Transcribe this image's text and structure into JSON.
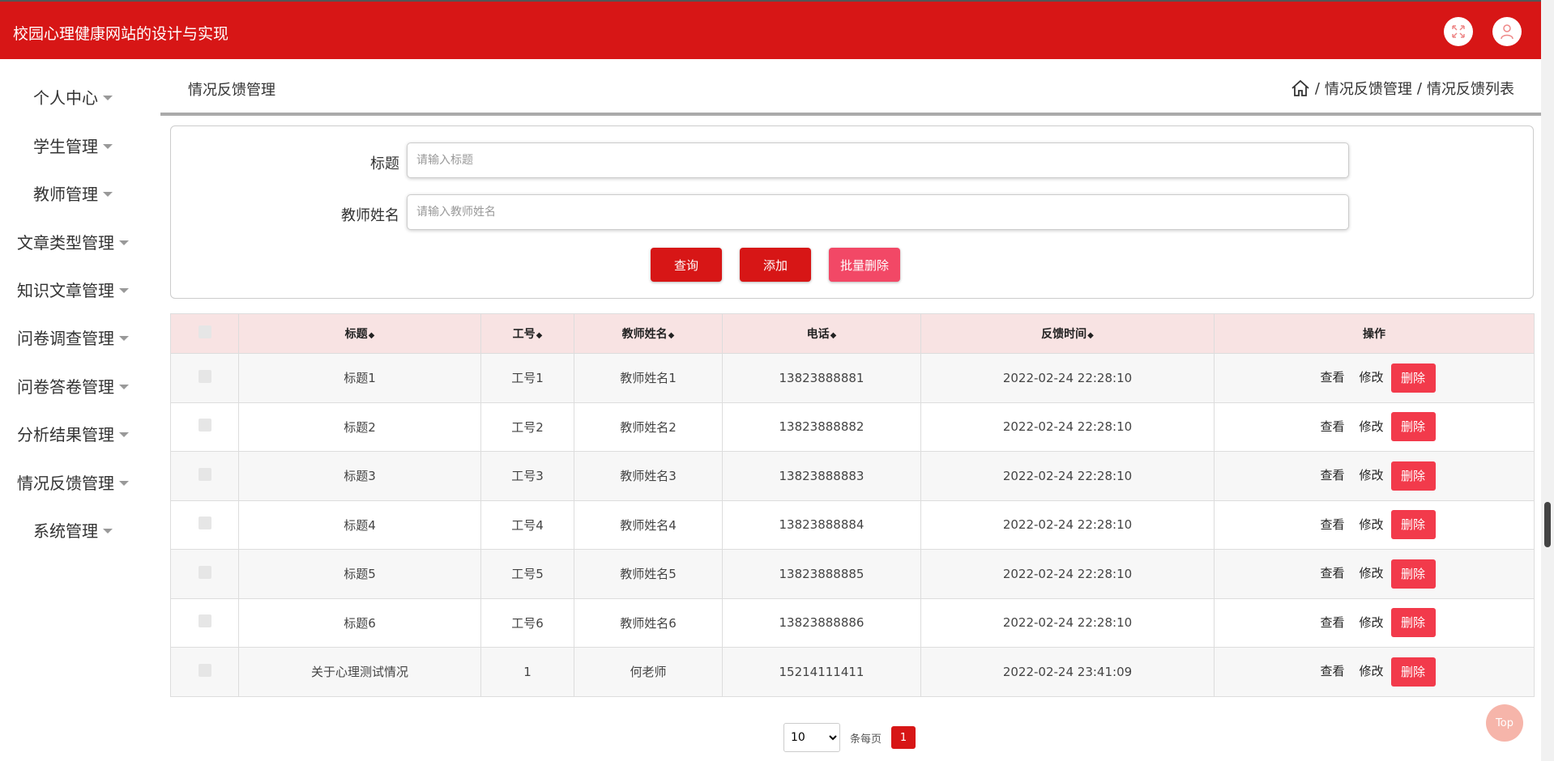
{
  "app": {
    "title": "校园心理健康网站的设计与实现"
  },
  "sidebar": {
    "items": [
      {
        "label": "个人中心"
      },
      {
        "label": "学生管理"
      },
      {
        "label": "教师管理"
      },
      {
        "label": "文章类型管理"
      },
      {
        "label": "知识文章管理"
      },
      {
        "label": "问卷调查管理"
      },
      {
        "label": "问卷答卷管理"
      },
      {
        "label": "分析结果管理"
      },
      {
        "label": "情况反馈管理"
      },
      {
        "label": "系统管理"
      }
    ]
  },
  "header": {
    "title": "情况反馈管理",
    "breadcrumb": [
      "情况反馈管理",
      "情况反馈列表"
    ],
    "separator": "/"
  },
  "filter": {
    "title_label": "标题",
    "title_placeholder": "请输入标题",
    "teacher_label": "教师姓名",
    "teacher_placeholder": "请输入教师姓名",
    "query_label": "查询",
    "add_label": "添加",
    "batch_delete_label": "批量删除"
  },
  "table": {
    "columns": [
      "标题",
      "工号",
      "教师姓名",
      "电话",
      "反馈时间",
      "操作"
    ],
    "sort_icon": "sort-icon",
    "rows": [
      {
        "title": "标题1",
        "id": "工号1",
        "teacher": "教师姓名1",
        "phone": "13823888881",
        "time": "2022-02-24 22:28:10"
      },
      {
        "title": "标题2",
        "id": "工号2",
        "teacher": "教师姓名2",
        "phone": "13823888882",
        "time": "2022-02-24 22:28:10"
      },
      {
        "title": "标题3",
        "id": "工号3",
        "teacher": "教师姓名3",
        "phone": "13823888883",
        "time": "2022-02-24 22:28:10"
      },
      {
        "title": "标题4",
        "id": "工号4",
        "teacher": "教师姓名4",
        "phone": "13823888884",
        "time": "2022-02-24 22:28:10"
      },
      {
        "title": "标题5",
        "id": "工号5",
        "teacher": "教师姓名5",
        "phone": "13823888885",
        "time": "2022-02-24 22:28:10"
      },
      {
        "title": "标题6",
        "id": "工号6",
        "teacher": "教师姓名6",
        "phone": "13823888886",
        "time": "2022-02-24 22:28:10"
      },
      {
        "title": "关于心理测试情况",
        "id": "1",
        "teacher": "何老师",
        "phone": "15214111411",
        "time": "2022-02-24 23:41:09"
      }
    ],
    "actions": {
      "view": "查看",
      "edit": "修改",
      "delete": "删除"
    }
  },
  "pager": {
    "page_size": "10",
    "per_page_label": "条每页",
    "current_page": "1"
  },
  "back_to_top": "Top",
  "colors": {
    "primary": "#d71616",
    "accent": "#f24866",
    "header_row": "#f8e3e3"
  }
}
